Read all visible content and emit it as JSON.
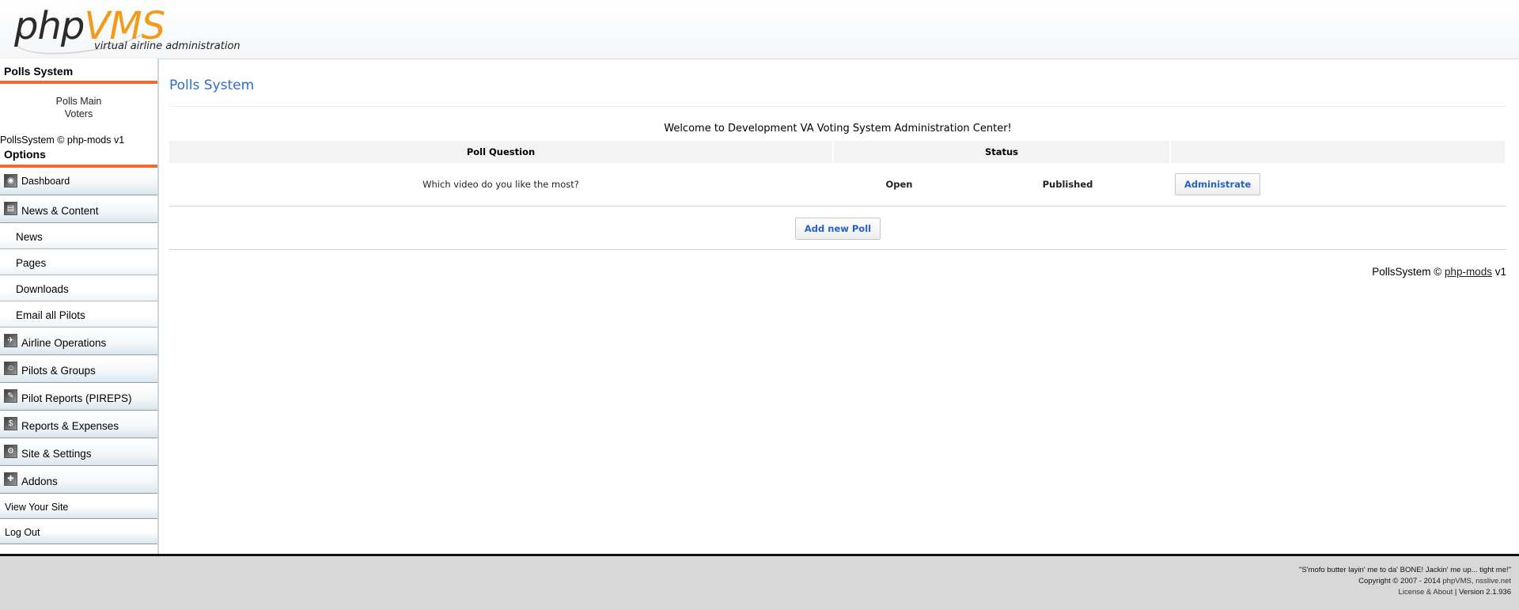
{
  "header": {
    "logo_php": "php",
    "logo_vms": "VMS",
    "logo_tagline": "virtual airline administration"
  },
  "sidebar": {
    "polls_title": "Polls System",
    "polls_links": [
      "Polls Main",
      "Voters"
    ],
    "polls_copyright": "PollsSystem © php-mods v1",
    "options_title": "Options",
    "menu": {
      "dashboard": "Dashboard",
      "news_content": "News & Content",
      "news": "News",
      "pages": "Pages",
      "downloads": "Downloads",
      "email_pilots": "Email all Pilots",
      "airline_ops": "Airline Operations",
      "pilots_groups": "Pilots & Groups",
      "pireps": "Pilot Reports (PIREPS)",
      "reports_expenses": "Reports & Expenses",
      "site_settings": "Site & Settings",
      "addons": "Addons",
      "view_site": "View Your Site",
      "log_out": "Log Out"
    }
  },
  "main": {
    "title": "Polls System",
    "welcome": "Welcome to Development VA Voting System Administration Center!",
    "table": {
      "headers": [
        "Poll Question",
        "Status",
        ""
      ],
      "rows": [
        {
          "question": "Which video do you like the most?",
          "status": "Open",
          "published": "Published",
          "action": "Administrate"
        }
      ]
    },
    "add_button": "Add new Poll",
    "copyright_prefix": "PollsSystem ©",
    "copyright_link": "php-mods",
    "copyright_suffix": "v1"
  },
  "footer": {
    "quote": "\"S'mofo butter layin' me to da' BONE! Jackin' me up... tight me!\"",
    "copyright_prefix": "Copyright © 2007 - 2014",
    "copyright_links": "phpVMS, nsslive.net",
    "license_link": "License & About",
    "version": "Version 2.1.936"
  },
  "colors": {
    "accent_orange": "#f26a2b",
    "logo_orange": "#f39a1b",
    "title_blue": "#2d6cd1",
    "status_green": "#0a8a0a"
  }
}
